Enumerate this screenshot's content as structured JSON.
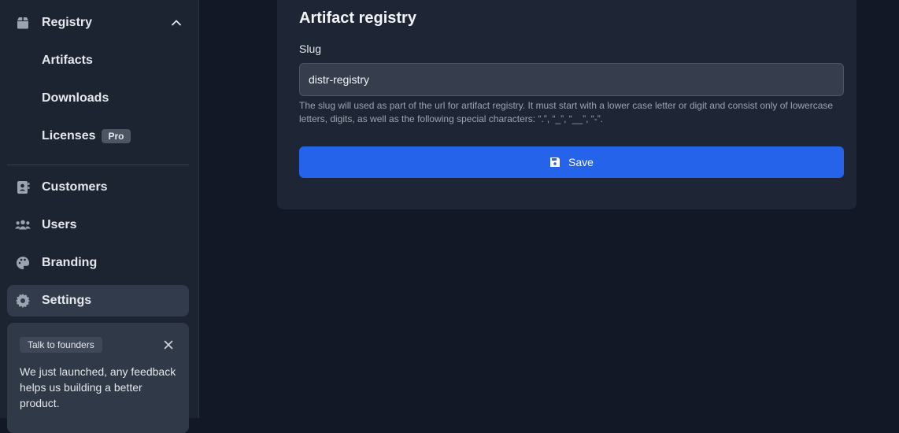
{
  "sidebar": {
    "registry": {
      "label": "Registry",
      "icon": "box-icon",
      "expanded": true
    },
    "sub_items": [
      {
        "label": "Artifacts"
      },
      {
        "label": "Downloads"
      },
      {
        "label": "Licenses",
        "badge": "Pro"
      }
    ],
    "items": [
      {
        "label": "Customers",
        "icon": "address-book-icon"
      },
      {
        "label": "Users",
        "icon": "users-icon"
      },
      {
        "label": "Branding",
        "icon": "palette-icon"
      },
      {
        "label": "Settings",
        "icon": "gear-icon",
        "active": true
      }
    ],
    "founders": {
      "tag": "Talk to founders",
      "message": "We just launched, any feedback helps us building a better product."
    }
  },
  "main": {
    "title": "Artifact registry",
    "slug_label": "Slug",
    "slug_value": "distr-registry",
    "help_text": "The slug will used as part of the url for artifact registry. It must start with a lower case letter or digit and consist only of lowercase letters, digits, as well as the following special characters: “.”, “_”, “__”, “-”.",
    "save_label": "Save"
  },
  "colors": {
    "accent": "#2563eb",
    "background": "#121826",
    "sidebar": "#1c2432",
    "card": "#1e2635"
  }
}
